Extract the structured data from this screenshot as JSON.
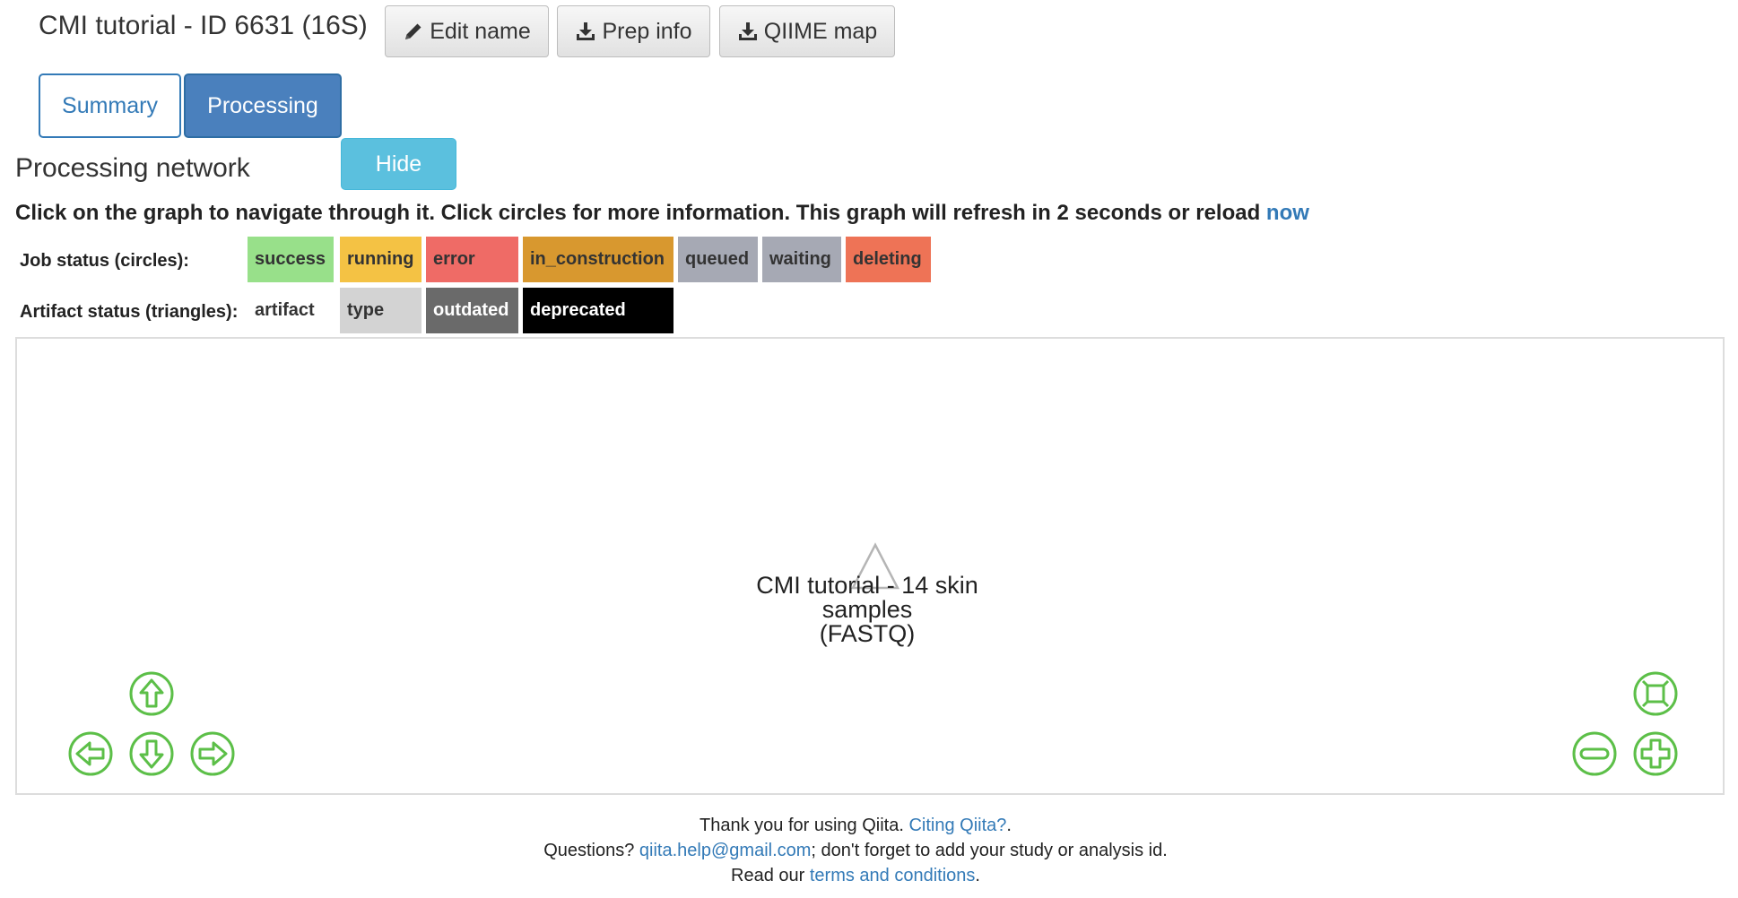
{
  "header": {
    "title": "CMI tutorial - ID 6631 (16S)",
    "edit_name_label": "Edit name",
    "prep_info_label": "Prep info",
    "qiime_map_label": "QIIME map"
  },
  "tabs": [
    {
      "label": "Summary",
      "active": false
    },
    {
      "label": "Processing",
      "active": true
    }
  ],
  "section": {
    "title": "Processing network",
    "hide_label": "Hide",
    "instructions": "Click on the graph to navigate through it. Click circles for more information. This graph will refresh in 2 seconds or reload",
    "reload_link": "now"
  },
  "legend": {
    "job_status_label": "Job status (circles):",
    "job_statuses": [
      {
        "label": "success",
        "color": "#98e08a"
      },
      {
        "label": "running",
        "color": "#f4c244"
      },
      {
        "label": "error",
        "color": "#ef6b66"
      },
      {
        "label": "in_construction",
        "color": "#d8982f"
      },
      {
        "label": "queued",
        "color": "#a6a9b4"
      },
      {
        "label": "waiting",
        "color": "#a6a9b4"
      },
      {
        "label": "deleting",
        "color": "#ee7356"
      }
    ],
    "artifact_status_label": "Artifact status (triangles):",
    "artifact_statuses": [
      {
        "label": "artifact",
        "color": "#ffffff"
      },
      {
        "label": "type",
        "color": "#d3d3d3"
      },
      {
        "label": "outdated",
        "color": "#6a6a6a"
      },
      {
        "label": "deprecated",
        "color": "#000000"
      }
    ]
  },
  "graph": {
    "node": {
      "line1": "CMI tutorial - 14 skin",
      "line2": "samples",
      "line3": "(FASTQ)"
    },
    "controls_color": "#5cbf48"
  },
  "footer": {
    "thanks_text": "Thank you for using Qiita.",
    "citing_link": "Citing Qiita?",
    "citing_suffix": ".",
    "questions_text": "Questions?",
    "email_link": "qiita.help@gmail.com",
    "questions_suffix": "; don't forget to add your study or analysis id.",
    "read_text": "Read our",
    "terms_link": "terms and conditions",
    "terms_suffix": "."
  }
}
